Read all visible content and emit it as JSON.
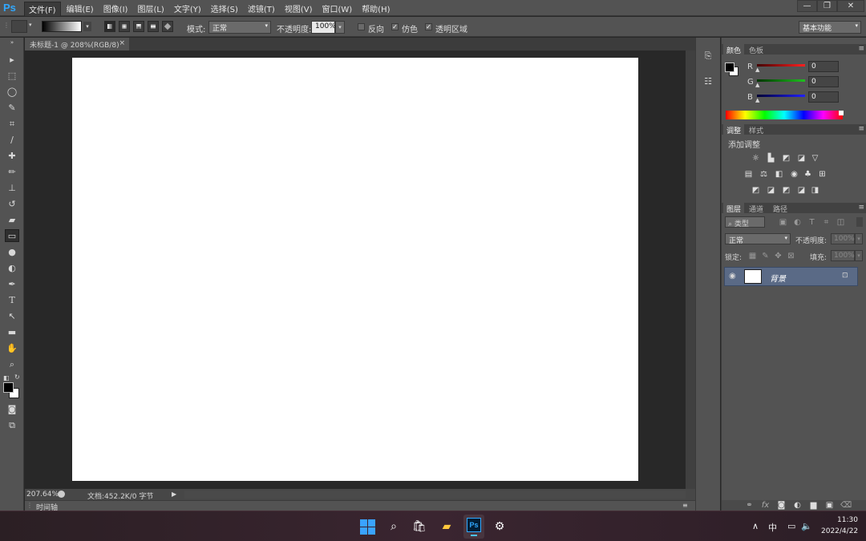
{
  "app": {
    "logo": "Ps",
    "accent": "#31a8ff"
  },
  "menu": {
    "items": [
      "文件(F)",
      "编辑(E)",
      "图像(I)",
      "图层(L)",
      "文字(Y)",
      "选择(S)",
      "滤镜(T)",
      "视图(V)",
      "窗口(W)",
      "帮助(H)"
    ]
  },
  "window_controls": {
    "minimize": "—",
    "restore": "❐",
    "close": "✕"
  },
  "options": {
    "mode_label": "模式:",
    "mode_value": "正常",
    "opacity_label": "不透明度:",
    "opacity_value": "100%",
    "reverse_label": "反向",
    "dither_label": "仿色",
    "transparency_label": "透明区域",
    "reverse_checked": false,
    "dither_checked": true,
    "transparency_checked": true,
    "workspace": "基本功能"
  },
  "document": {
    "tab_title": "未标题-1 @ 208%(RGB/8)",
    "tab_close": "×",
    "zoom": "207.64%",
    "doc_info": "文档:452.2K/0 字节",
    "timeline_label": "时间轴"
  },
  "color_panel": {
    "tab_color": "颜色",
    "tab_swatches": "色板",
    "r_label": "R",
    "g_label": "G",
    "b_label": "B",
    "r_value": "0",
    "g_value": "0",
    "b_value": "0",
    "r_color": "#ff2020",
    "g_color": "#20c020",
    "b_color": "#2020ff"
  },
  "adjustments_panel": {
    "tab_adjust": "调整",
    "tab_styles": "样式",
    "title": "添加调整"
  },
  "layers_panel": {
    "tab_layers": "图层",
    "tab_channels": "通道",
    "tab_paths": "路径",
    "filter_kind": "类型",
    "blend_mode": "正常",
    "opacity_label": "不透明度:",
    "opacity_value": "100%",
    "lock_label": "锁定:",
    "fill_label": "填充:",
    "fill_value": "100%",
    "layer_name": "背景"
  },
  "taskbar": {
    "ime": "中",
    "time": "11:30",
    "date": "2022/4/22"
  }
}
